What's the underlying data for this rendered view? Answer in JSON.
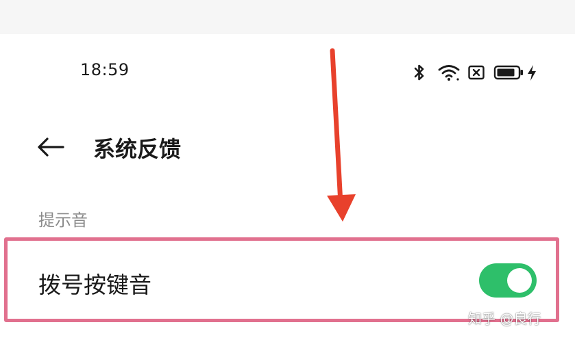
{
  "status_bar": {
    "time": "18:59",
    "icons": [
      "bluetooth-icon",
      "wifi-icon",
      "sim-blocked-icon",
      "battery-icon",
      "charging-icon"
    ]
  },
  "nav": {
    "back_icon": "back-arrow-icon",
    "title": "系统反馈"
  },
  "section": {
    "header": "提示音"
  },
  "settings": {
    "dialpad_tone": {
      "label": "拨号按键音",
      "enabled": true
    }
  },
  "annotation": {
    "arrow_color": "#e8412c",
    "highlight_color": "#e1708e"
  },
  "colors": {
    "toggle_on": "#2ebf6a"
  },
  "watermark": "知乎 @良行"
}
